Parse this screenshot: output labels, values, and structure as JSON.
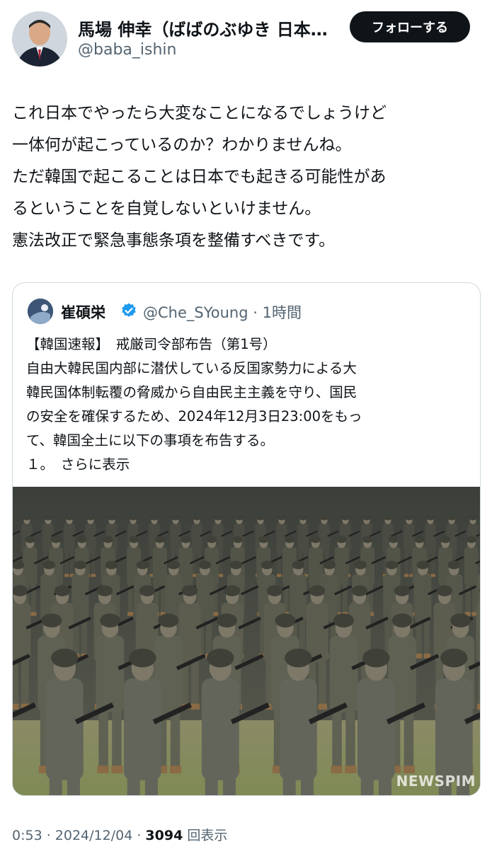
{
  "author": {
    "name": "馬場 伸幸（ばばのぶゆき 日本…",
    "handle": "@baba_ishin",
    "follow_label": "フォローする"
  },
  "tweet_lines": [
    "これ日本でやったら大変なことになるでしょうけど",
    "一体何が起こっているのか？わかりませんね。",
    "ただ韓国で起こることは日本でも起きる可能性があ",
    "るということを自覚しないといけません。",
    "憲法改正で緊急事態条項を整備すべきです。"
  ],
  "quote": {
    "name": "崔碩栄",
    "handle_time": "@Che_SYoung · 1時間",
    "lines": [
      "【韓国速報】　戒厳司令部布告（第1号）",
      "自由大韓民国内部に潜伏している反国家勢力による大",
      "韓民国体制転覆の脅威から自由民主主義を守り、国民",
      "の安全を確保するため、2024年12月3日23:00をもっ",
      "て、韓国全土に以下の事項を布告する。"
    ],
    "last_prefix": "１。",
    "show_more": "さらに表示",
    "watermark": "NEWSPIM"
  },
  "meta": {
    "time_date": "0:53 · 2024/12/04 · ",
    "views_count": "3094",
    "views_label": " 回表示"
  },
  "colors": {
    "text": "#0f1419",
    "muted": "#536471",
    "border": "#cfd9de",
    "verified": "#1d9bf0"
  }
}
